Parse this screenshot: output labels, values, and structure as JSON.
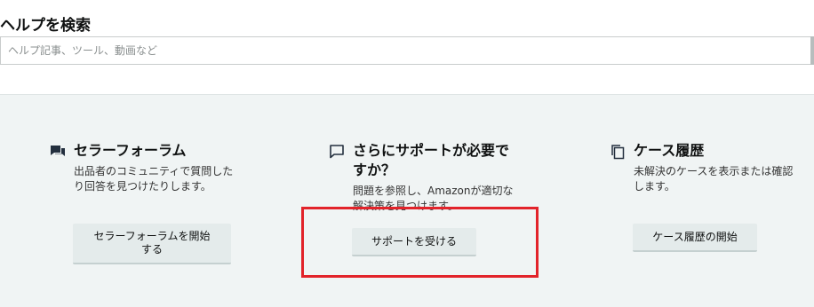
{
  "search": {
    "title": "ヘルプを検索",
    "placeholder": "ヘルプ記事、ツール、動画など"
  },
  "cards": [
    {
      "icon": "forum-icon",
      "title": "セラーフォーラム",
      "desc_line1": "出品者のコミュニティで質問した",
      "desc_line2": "り回答を見つけたりします。",
      "button_line1": "セラーフォーラムを開始",
      "button_line2": "する"
    },
    {
      "icon": "chat-icon",
      "title_line1": "さらにサポートが必要で",
      "title_line2": "すか？",
      "desc_line1": "問題を参照し、Amazonが適切な",
      "desc_line2": "解決策を見つけます。",
      "button": "サポートを受ける"
    },
    {
      "icon": "copy-icon",
      "title": "ケース履歴",
      "desc_line1": "未解決のケースを表示または確認",
      "desc_line2": "します。",
      "button": "ケース履歴の開始"
    }
  ],
  "colors": {
    "panel_bg": "#f0f4f4",
    "button_bg": "#e4ebeb",
    "highlight": "#e2232a"
  }
}
